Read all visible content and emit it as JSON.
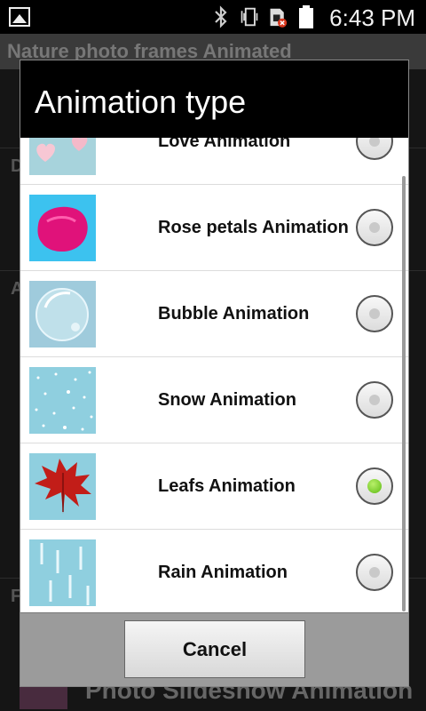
{
  "status_bar": {
    "time": "6:43 PM",
    "icons": [
      "gallery-icon",
      "bluetooth-icon",
      "vibrate-icon",
      "sim-error-icon",
      "battery-icon"
    ]
  },
  "background_app": {
    "title": "Nature photo frames Animated",
    "rows": [
      "D",
      "A",
      "F"
    ],
    "bottom_item": "Photo Slideshow Animation"
  },
  "dialog": {
    "title": "Animation type",
    "cancel_label": "Cancel",
    "items": [
      {
        "label": "Love Animation",
        "thumb": "hearts-thumbnail",
        "selected": false
      },
      {
        "label": "Rose petals Animation",
        "thumb": "rose-petal-thumbnail",
        "selected": false
      },
      {
        "label": "Bubble Animation",
        "thumb": "bubble-thumbnail",
        "selected": false
      },
      {
        "label": "Snow Animation",
        "thumb": "snow-thumbnail",
        "selected": false
      },
      {
        "label": "Leafs Animation",
        "thumb": "leaf-thumbnail",
        "selected": true
      },
      {
        "label": "Rain Animation",
        "thumb": "rain-thumbnail",
        "selected": false
      }
    ]
  },
  "colors": {
    "selected_radio": "#5dbb13",
    "thumb_background": "#8fd0e0"
  }
}
